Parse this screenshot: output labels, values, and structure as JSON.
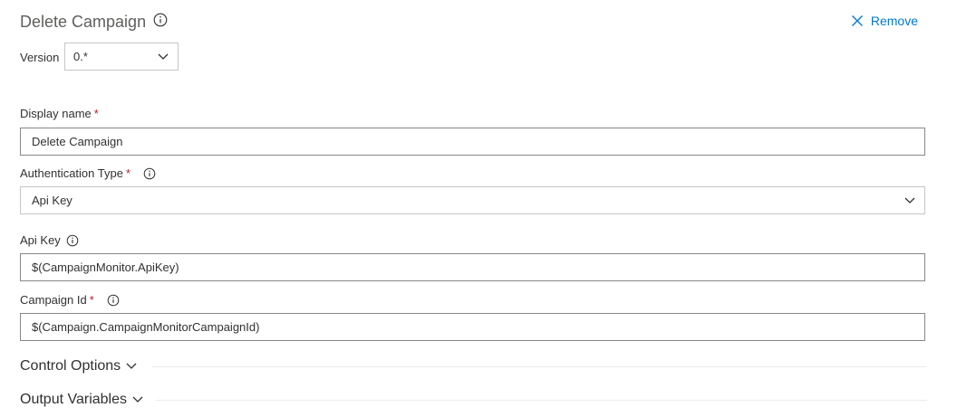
{
  "header": {
    "title": "Delete Campaign",
    "remove_label": "Remove"
  },
  "version": {
    "label": "Version",
    "value": "0.*"
  },
  "fields": {
    "display_name": {
      "label": "Display name",
      "required": "*",
      "value": "Delete Campaign"
    },
    "auth_type": {
      "label": "Authentication Type",
      "required": "*",
      "value": "Api Key"
    },
    "api_key": {
      "label": "Api Key",
      "value": "$(CampaignMonitor.ApiKey)"
    },
    "campaign_id": {
      "label": "Campaign Id",
      "required": "*",
      "value": "$(Campaign.CampaignMonitorCampaignId)"
    }
  },
  "sections": {
    "control_options": "Control Options",
    "output_variables": "Output Variables"
  },
  "colors": {
    "accent": "#0078d4",
    "required": "#a4262c",
    "border": "#8a8886"
  }
}
